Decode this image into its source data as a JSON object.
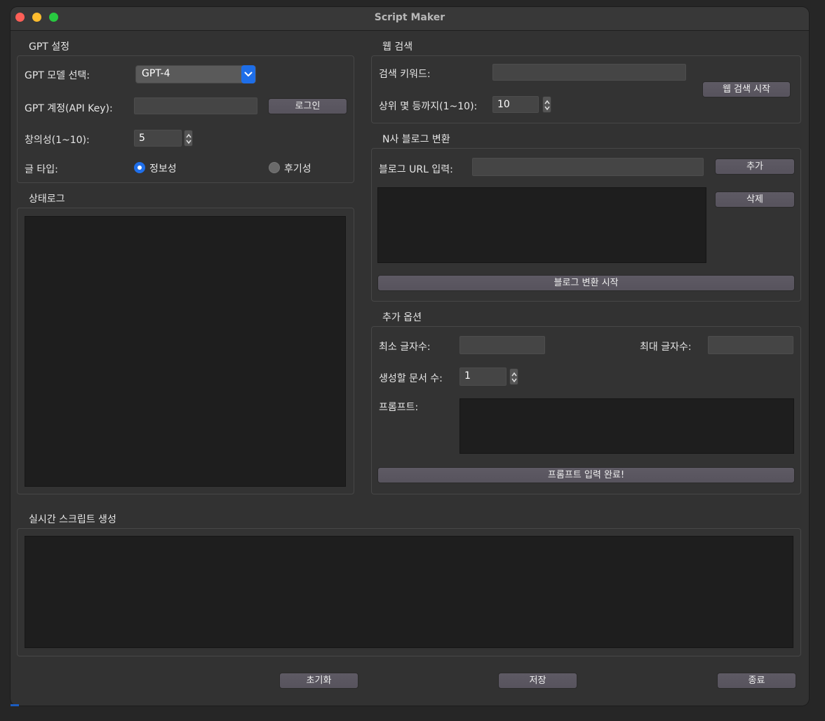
{
  "window": {
    "title": "Script Maker"
  },
  "gpt_settings": {
    "title": "GPT 설정",
    "model_label": "GPT 모델 선택:",
    "model_value": "GPT-4",
    "account_label": "GPT 계정(API Key):",
    "account_value": "",
    "login_button": "로그인",
    "creativity_label": "창의성(1~10):",
    "creativity_value": "5",
    "type_label": "글 타입:",
    "type_option1": "정보성",
    "type_option2": "후기성",
    "type_selected": "정보성"
  },
  "status_log": {
    "title": "상태로그"
  },
  "web_search": {
    "title": "웹 검색",
    "keyword_label": "검색 키워드:",
    "keyword_value": "",
    "top_label": "상위 몇 등까지(1~10):",
    "top_value": "10",
    "start_button": "웹 검색 시작"
  },
  "blog_convert": {
    "title": "N사 블로그 변환",
    "url_label": "블로그 URL 입력:",
    "url_value": "",
    "add_button": "추가",
    "delete_button": "삭제",
    "start_button": "블로그 변환 시작"
  },
  "extra_options": {
    "title": "추가 옵션",
    "min_label": "최소 글자수:",
    "min_value": "",
    "max_label": "최대 글자수:",
    "max_value": "",
    "count_label": "생성할 문서 수:",
    "count_value": "1",
    "prompt_label": "프롬프트:",
    "prompt_done_button": "프롬프트 입력 완료!"
  },
  "realtime": {
    "title": "실시간 스크립트 생성"
  },
  "footer": {
    "reset_button": "초기화",
    "save_button": "저장",
    "exit_button": "종료"
  },
  "colors": {
    "accent": "#1f6fea",
    "window_bg": "#323232",
    "textarea_bg": "#1e1e1e"
  }
}
